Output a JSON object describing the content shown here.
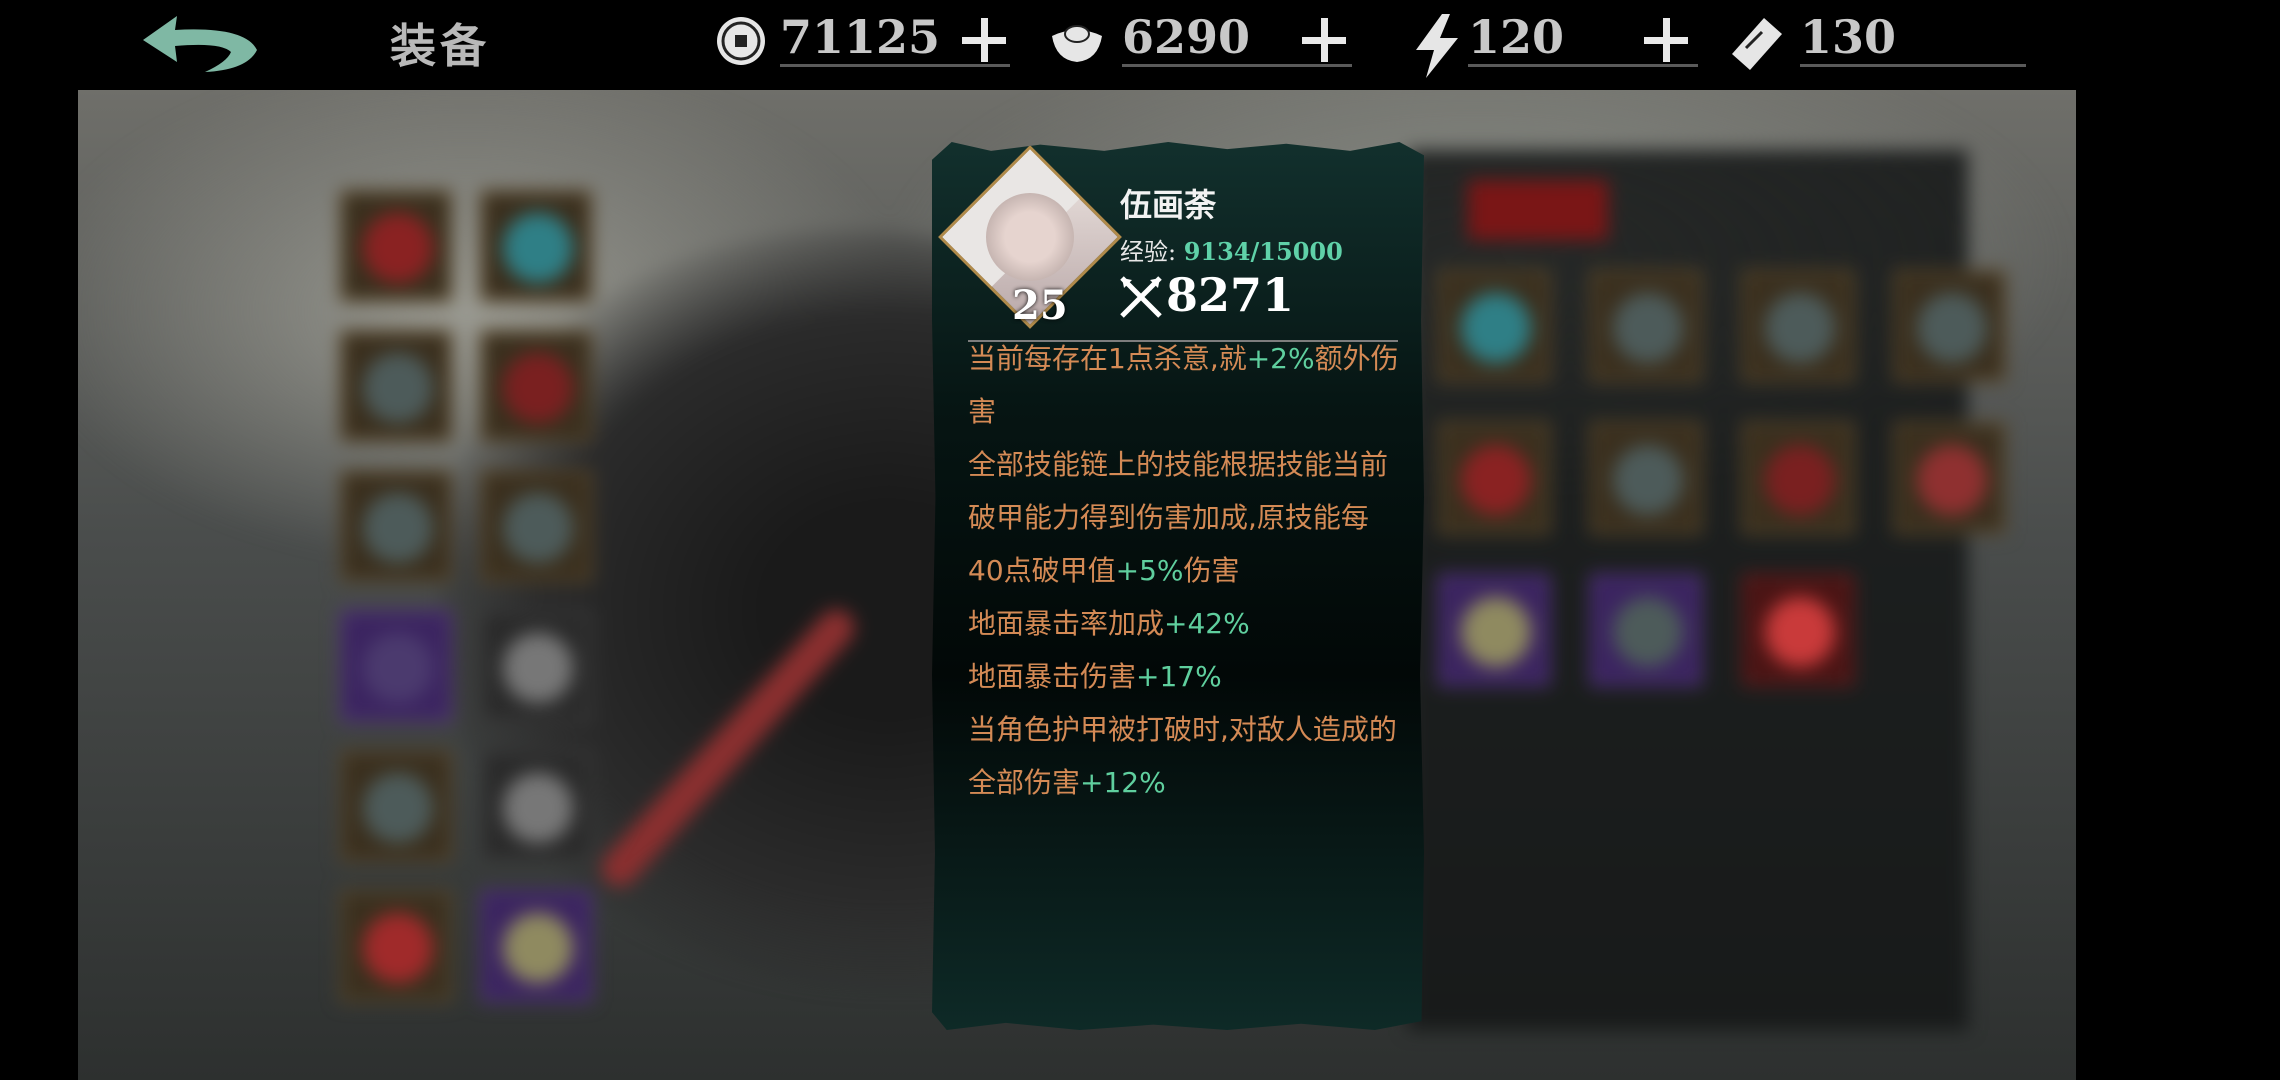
{
  "header": {
    "title": "装备"
  },
  "resources": [
    {
      "name": "coin",
      "icon": "coin-icon",
      "value": "71125"
    },
    {
      "name": "ingot",
      "icon": "silver-ingot-icon",
      "value": "6290"
    },
    {
      "name": "energy",
      "icon": "lightning-icon",
      "value": "120"
    },
    {
      "name": "ticket",
      "icon": "ticket-icon",
      "value": "130"
    }
  ],
  "hero": {
    "name": "伍画荼",
    "level": "25",
    "exp_label": "经验:",
    "exp_value": "9134/15000",
    "power": "8271"
  },
  "description": [
    {
      "pre": "当前每存在1点杀意,就",
      "val": "+2%",
      "post": "额外伤害"
    },
    {
      "pre": "全部技能链上的技能根据技能当前破甲能力得到伤害加成,原技能每40点破甲值",
      "val": "+5%",
      "post": "伤害"
    },
    {
      "pre": "地面暴击率加成",
      "val": "+42%",
      "post": ""
    },
    {
      "pre": "地面暴击伤害",
      "val": "+17%",
      "post": ""
    },
    {
      "pre": "当角色护甲被打破时,对敌人造成的全部伤害",
      "val": "+12%",
      "post": ""
    }
  ],
  "colors": {
    "accent_green": "#5fcf9e",
    "desc_orange": "#d48a55",
    "popup_bg": "#061513"
  }
}
